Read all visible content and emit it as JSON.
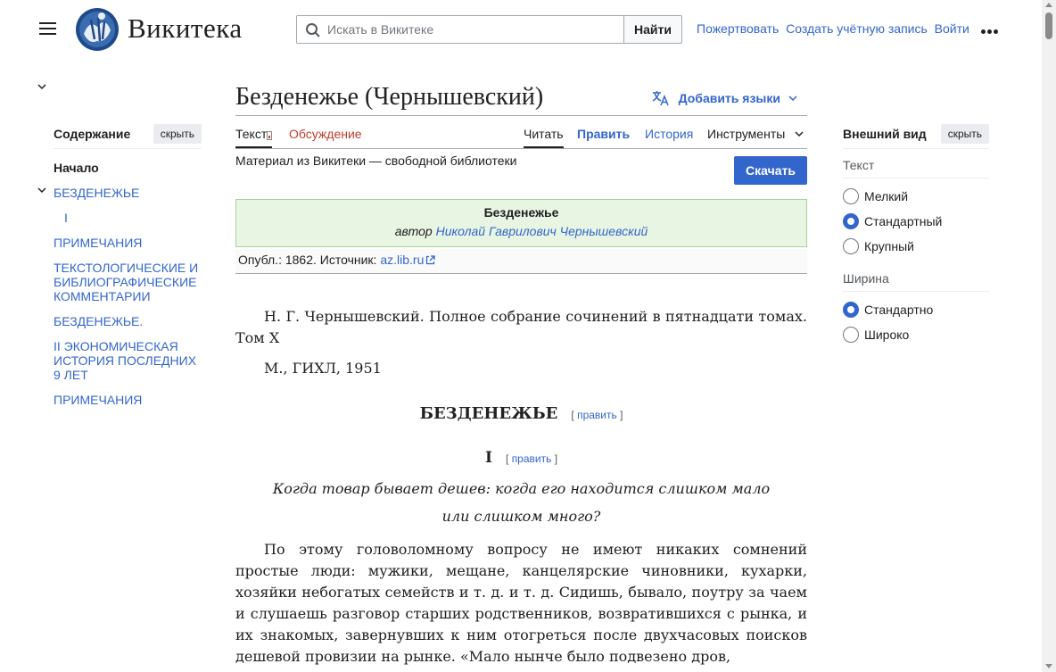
{
  "header": {
    "wordmark": "Викитека",
    "search_placeholder": "Искать в Викитеке",
    "search_button": "Найти",
    "donate": "Пожертвовать",
    "create_account": "Создать учётную запись",
    "login": "Войти"
  },
  "toc": {
    "title": "Содержание",
    "hide": "скрыть",
    "items": [
      "Начало",
      "БЕЗДЕНЕЖЬЕ",
      "I",
      "ПРИМЕЧАНИЯ",
      "ТЕКСТОЛОГИЧЕСКИЕ И БИБЛИОГРАФИЧЕСКИЕ КОММЕНТАРИИ",
      "БЕЗДЕНЕЖЬЕ.",
      "II ЭКОНОМИЧЕСКАЯ ИСТОРИЯ ПОСЛЕДНИХ 9 ЛЕТ",
      "ПРИМЕЧАНИЯ"
    ]
  },
  "appearance": {
    "title": "Внешний вид",
    "hide": "скрыть",
    "text_label": "Текст",
    "text_options": [
      "Мелкий",
      "Стандартный",
      "Крупный"
    ],
    "text_selected": "Стандартный",
    "width_label": "Ширина",
    "width_options": [
      "Стандартно",
      "Широко"
    ],
    "width_selected": "Стандартно"
  },
  "page": {
    "title": "Безденежье (Чернышевский)",
    "add_languages": "Добавить языки",
    "tabs": {
      "text": "Текст",
      "discussion": "Обсуждение",
      "read": "Читать",
      "edit": "Править",
      "history": "История",
      "tools": "Инструменты"
    },
    "site_sub": "Материал из Викитеки — свободной библиотеки",
    "download": "Скачать",
    "work_title": "Безденежье",
    "author_prefix": "автор",
    "author": "Николай Гаврилович Чернышевский",
    "pub_text": "Опубл.: 1862. Источник:",
    "pub_source": "az.lib.ru",
    "source_line1": "Н. Г. Чернышевский. Полное собрание сочинений в пятнадцати томах. Том X",
    "source_line2": "М., ГИХЛ, 1951",
    "heading": "БЕЗДЕНЕЖЬЕ",
    "edit_label": "править",
    "section": "I",
    "epigraph1": "Когда товар бывает дешев: когда его находится слишком мало",
    "epigraph2": "или слишком много?",
    "paragraph": "По этому головоломному вопросу не имеют никаких сомнений простые люди: мужики, мещане, канцелярские чиновники, кухарки, хозяйки небогатых семейств и т. д. и т. д. Сидишь, бывало, поутру за чаем и слушаешь разговор старших родственников, возвратившихся с рынка, и их знакомых, завернувших к ним отогреться после двухчасовых поисков дешевой провизии на рынке. «Мало нынче было подвезено дров,"
  }
}
